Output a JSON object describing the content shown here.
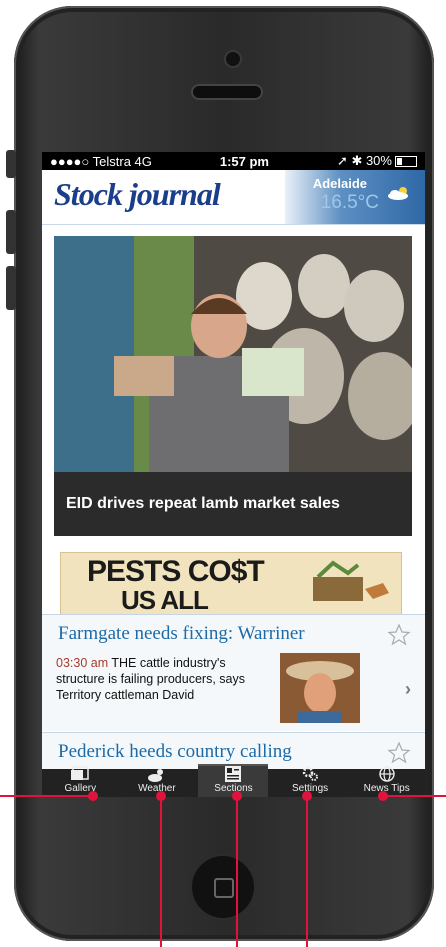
{
  "status": {
    "carrier": "●●●●○ Telstra  4G",
    "time": "1:57 pm",
    "battery": "30%",
    "battery_level": 0.3
  },
  "header": {
    "logo": "Stock journal",
    "city": "Adelaide",
    "temperature": "16.5°C",
    "weather_icon": "cloud-sun-icon"
  },
  "hero": {
    "headline": "EID drives repeat lamb market sales"
  },
  "ad": {
    "line1": "PESTS CO$T",
    "line2": "US ALL"
  },
  "articles": [
    {
      "title": "Farmgate needs fixing: Warriner",
      "time": "03:30 am",
      "summary": "THE cattle industry's structure is failing producers, says Territory cattleman David"
    },
    {
      "title": "Pederick heeds country calling"
    }
  ],
  "tabs": [
    {
      "label": "Gallery",
      "icon": "gallery-icon"
    },
    {
      "label": "Weather",
      "icon": "weather-icon"
    },
    {
      "label": "Sections",
      "icon": "sections-icon"
    },
    {
      "label": "Settings",
      "icon": "settings-icon"
    },
    {
      "label": "News Tips",
      "icon": "globe-icon"
    }
  ],
  "colors": {
    "accent": "#1e6aa6",
    "logo": "#1b3e8a",
    "annotation": "#e2133b",
    "time": "#a73c2b"
  }
}
